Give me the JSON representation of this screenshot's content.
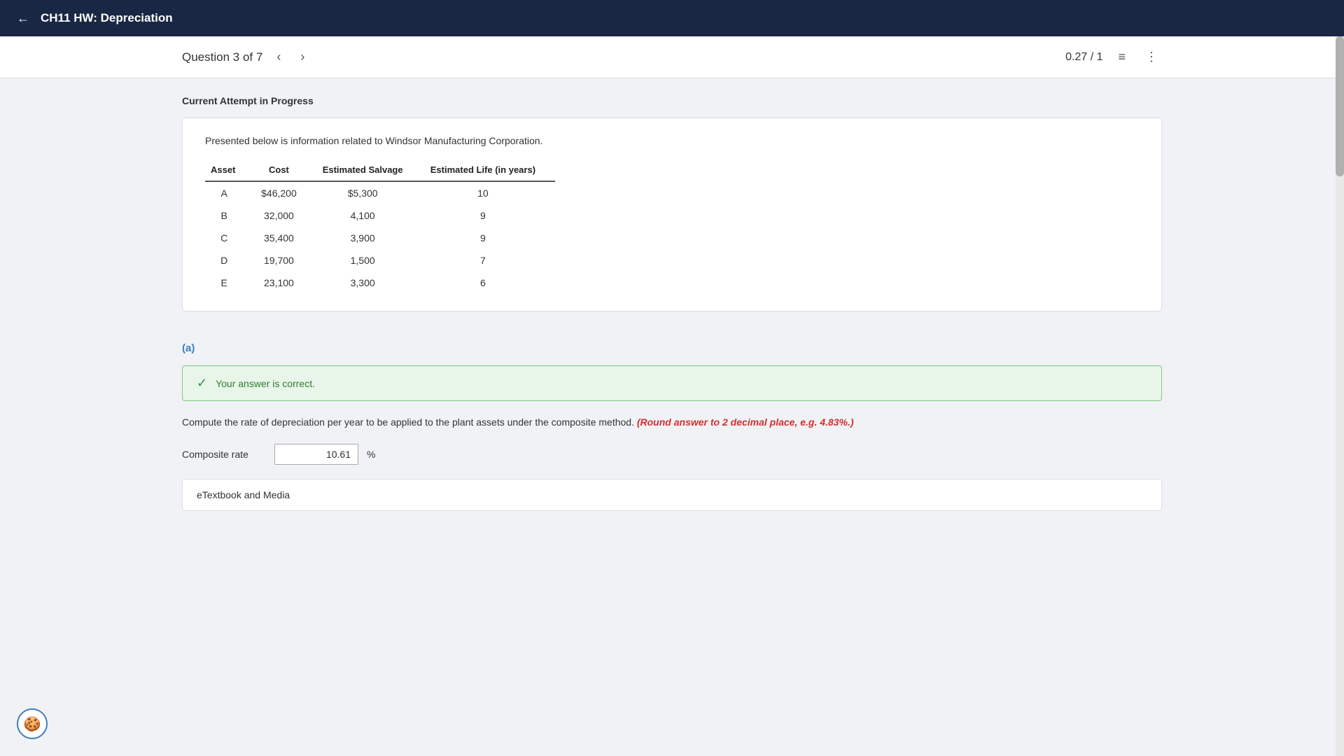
{
  "topbar": {
    "back_icon": "←",
    "title": "CH11 HW: Depreciation"
  },
  "question_nav": {
    "label": "Question 3 of 7",
    "prev_icon": "‹",
    "next_icon": "›",
    "score": "0.27 / 1",
    "list_icon": "≡",
    "more_icon": "⋮"
  },
  "attempt": {
    "label": "Current Attempt in Progress"
  },
  "info_card": {
    "description": "Presented below is information related to Windsor Manufacturing Corporation.",
    "table": {
      "headers": [
        "Asset",
        "Cost",
        "Estimated Salvage",
        "Estimated Life (in years)"
      ],
      "rows": [
        [
          "A",
          "$46,200",
          "$5,300",
          "10"
        ],
        [
          "B",
          "32,000",
          "4,100",
          "9"
        ],
        [
          "C",
          "35,400",
          "3,900",
          "9"
        ],
        [
          "D",
          "19,700",
          "1,500",
          "7"
        ],
        [
          "E",
          "23,100",
          "3,300",
          "6"
        ]
      ]
    }
  },
  "part_a": {
    "label": "(a)",
    "correct_message": "Your answer is correct.",
    "question_text": "Compute the rate of depreciation per year to be applied to the plant assets under the composite method.",
    "question_note": "(Round answer to 2 decimal place, e.g. 4.83%.)",
    "composite_rate_label": "Composite rate",
    "composite_rate_value": "10.61",
    "composite_rate_unit": "%"
  },
  "etextbook": {
    "label": "eTextbook and Media"
  },
  "cookie": {
    "icon": "🍪"
  }
}
